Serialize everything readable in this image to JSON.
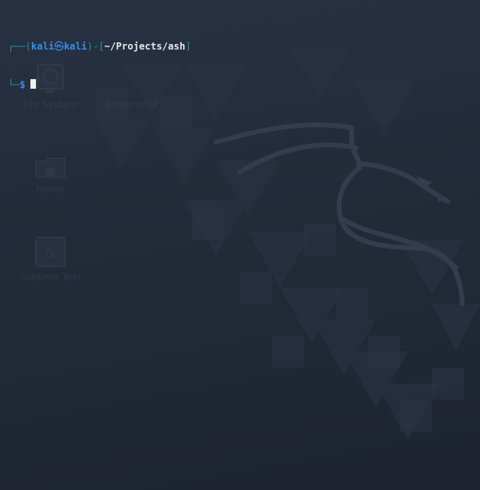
{
  "terminal": {
    "user": "kali",
    "at_symbol": "㉿",
    "host": "kali",
    "cwd": "~/Projects/ash",
    "prompt_symbol": "$"
  },
  "desktop_icons": [
    {
      "label": "File System",
      "icon": "monitor-icon"
    },
    {
      "label": "Home",
      "icon": "home-folder-icon"
    },
    {
      "label": "Sublime Text",
      "icon": "sublime-text-icon"
    }
  ],
  "partial_icon_label": "Screenshot",
  "colors": {
    "background": "#232b39",
    "prompt_blue": "#3b8eea",
    "frame_teal": "#2b8fa3",
    "path_white": "#e6e8ec"
  }
}
